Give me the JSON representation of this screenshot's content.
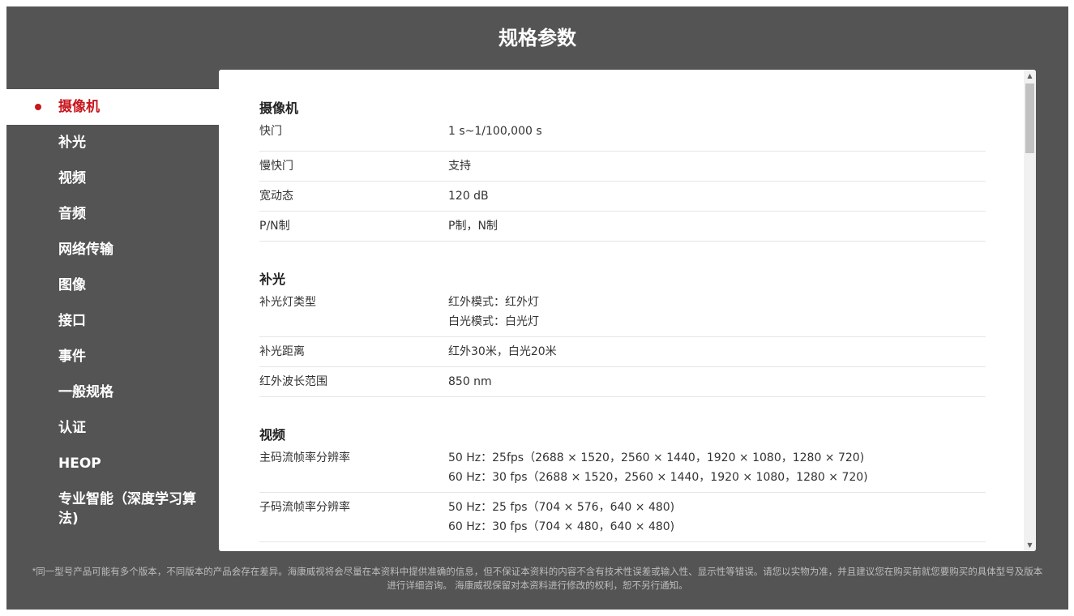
{
  "page_title": "规格参数",
  "sidebar": {
    "items": [
      {
        "label": "摄像机",
        "active": true
      },
      {
        "label": "补光"
      },
      {
        "label": "视频"
      },
      {
        "label": "音频"
      },
      {
        "label": "网络传输"
      },
      {
        "label": "图像"
      },
      {
        "label": "接口"
      },
      {
        "label": "事件"
      },
      {
        "label": "一般规格"
      },
      {
        "label": "认证"
      },
      {
        "label": "HEOP"
      },
      {
        "label": "专业智能（深度学习算法)"
      }
    ]
  },
  "sections": [
    {
      "title": "摄像机",
      "rows": [
        {
          "label": "快门",
          "values": [
            "1 s~1/100,000 s"
          ]
        },
        {
          "label": "慢快门",
          "values": [
            "支持"
          ]
        },
        {
          "label": "宽动态",
          "values": [
            "120 dB"
          ]
        },
        {
          "label": "P/N制",
          "values": [
            "P制，N制"
          ]
        }
      ]
    },
    {
      "title": "补光",
      "rows": [
        {
          "label": "补光灯类型",
          "values": [
            "红外模式：红外灯",
            "白光模式：白光灯"
          ]
        },
        {
          "label": "补光距离",
          "values": [
            "红外30米，白光20米"
          ]
        },
        {
          "label": "红外波长范围",
          "values": [
            "850 nm"
          ]
        }
      ]
    },
    {
      "title": "视频",
      "rows": [
        {
          "label": "主码流帧率分辨率",
          "values": [
            "50 Hz：25fps（2688 × 1520，2560 × 1440，1920 × 1080，1280 × 720)",
            "60 Hz：30 fps（2688 × 1520，2560 × 1440，1920 × 1080，1280 × 720)"
          ]
        },
        {
          "label": "子码流帧率分辨率",
          "values": [
            "50 Hz：25 fps（704 × 576，640 × 480)",
            "60 Hz：30 fps（704 × 480，640 × 480)"
          ]
        }
      ]
    }
  ],
  "scrollbar": {
    "up_icon": "▲",
    "down_icon": "▼"
  },
  "footer": {
    "line1": "*同一型号产品可能有多个版本，不同版本的产品会存在差异。海康威视将会尽量在本资料中提供准确的信息，但不保证本资料的内容不含有技术性误差或输入性、显示性等错误。请您以实物为准，并且建议您在购买前就您要购买的具体型号及版本",
    "line2": "进行详细咨询。 海康威视保留对本资料进行修改的权利，恕不另行通知。"
  },
  "colors": {
    "accent": "#c8161d",
    "frame": "#545454"
  }
}
